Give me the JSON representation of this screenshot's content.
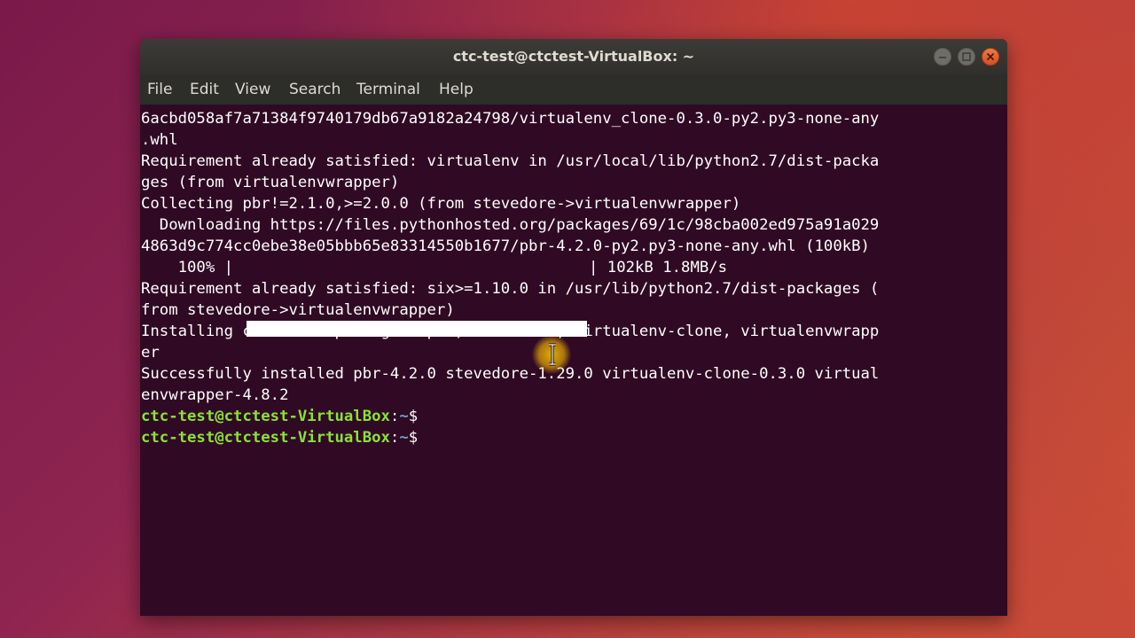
{
  "window": {
    "title": "ctc-test@ctctest-VirtualBox: ~",
    "buttons": [
      "minimize-icon",
      "maximize-icon",
      "close-icon"
    ]
  },
  "menubar": {
    "items": [
      "File",
      "Edit",
      "View",
      "Search",
      "Terminal",
      "Help"
    ]
  },
  "terminal": {
    "lines": [
      "6acbd058af7a71384f9740179db67a9182a24798/virtualenv_clone-0.3.0-py2.py3-none-any",
      ".whl",
      "Requirement already satisfied: virtualenv in /usr/local/lib/python2.7/dist-packa",
      "ges (from virtualenvwrapper)",
      "Collecting pbr!=2.1.0,>=2.0.0 (from stevedore->virtualenvwrapper)",
      "  Downloading https://files.pythonhosted.org/packages/69/1c/98cba002ed975a91a029",
      "4863d9c774cc0ebe38e05bbb65e83314550b1677/pbr-4.2.0-py2.py3-none-any.whl (100kB)"
    ],
    "progress": {
      "percent_label": "    100% |",
      "end_label": "| 102kB 1.8MB/s",
      "fraction": 1.0
    },
    "lines_after": [
      "Requirement already satisfied: six>=1.10.0 in /usr/lib/python2.7/dist-packages (",
      "from stevedore->virtualenvwrapper)",
      "Installing collected packages: pbr, stevedore, virtualenv-clone, virtualenvwrapp",
      "er",
      "Successfully installed pbr-4.2.0 stevedore-1.29.0 virtualenv-clone-0.3.0 virtual",
      "envwrapper-4.8.2"
    ],
    "prompts": [
      {
        "user": "ctc-test@ctctest-VirtualBox",
        "sep": ":",
        "path": "~",
        "sym": "$"
      },
      {
        "user": "ctc-test@ctctest-VirtualBox",
        "sep": ":",
        "path": "~",
        "sym": "$"
      }
    ]
  },
  "colors": {
    "terminal_bg": "#300a24",
    "prompt_user": "#8ae234",
    "prompt_path": "#729fcf",
    "accent": "#e95420"
  }
}
